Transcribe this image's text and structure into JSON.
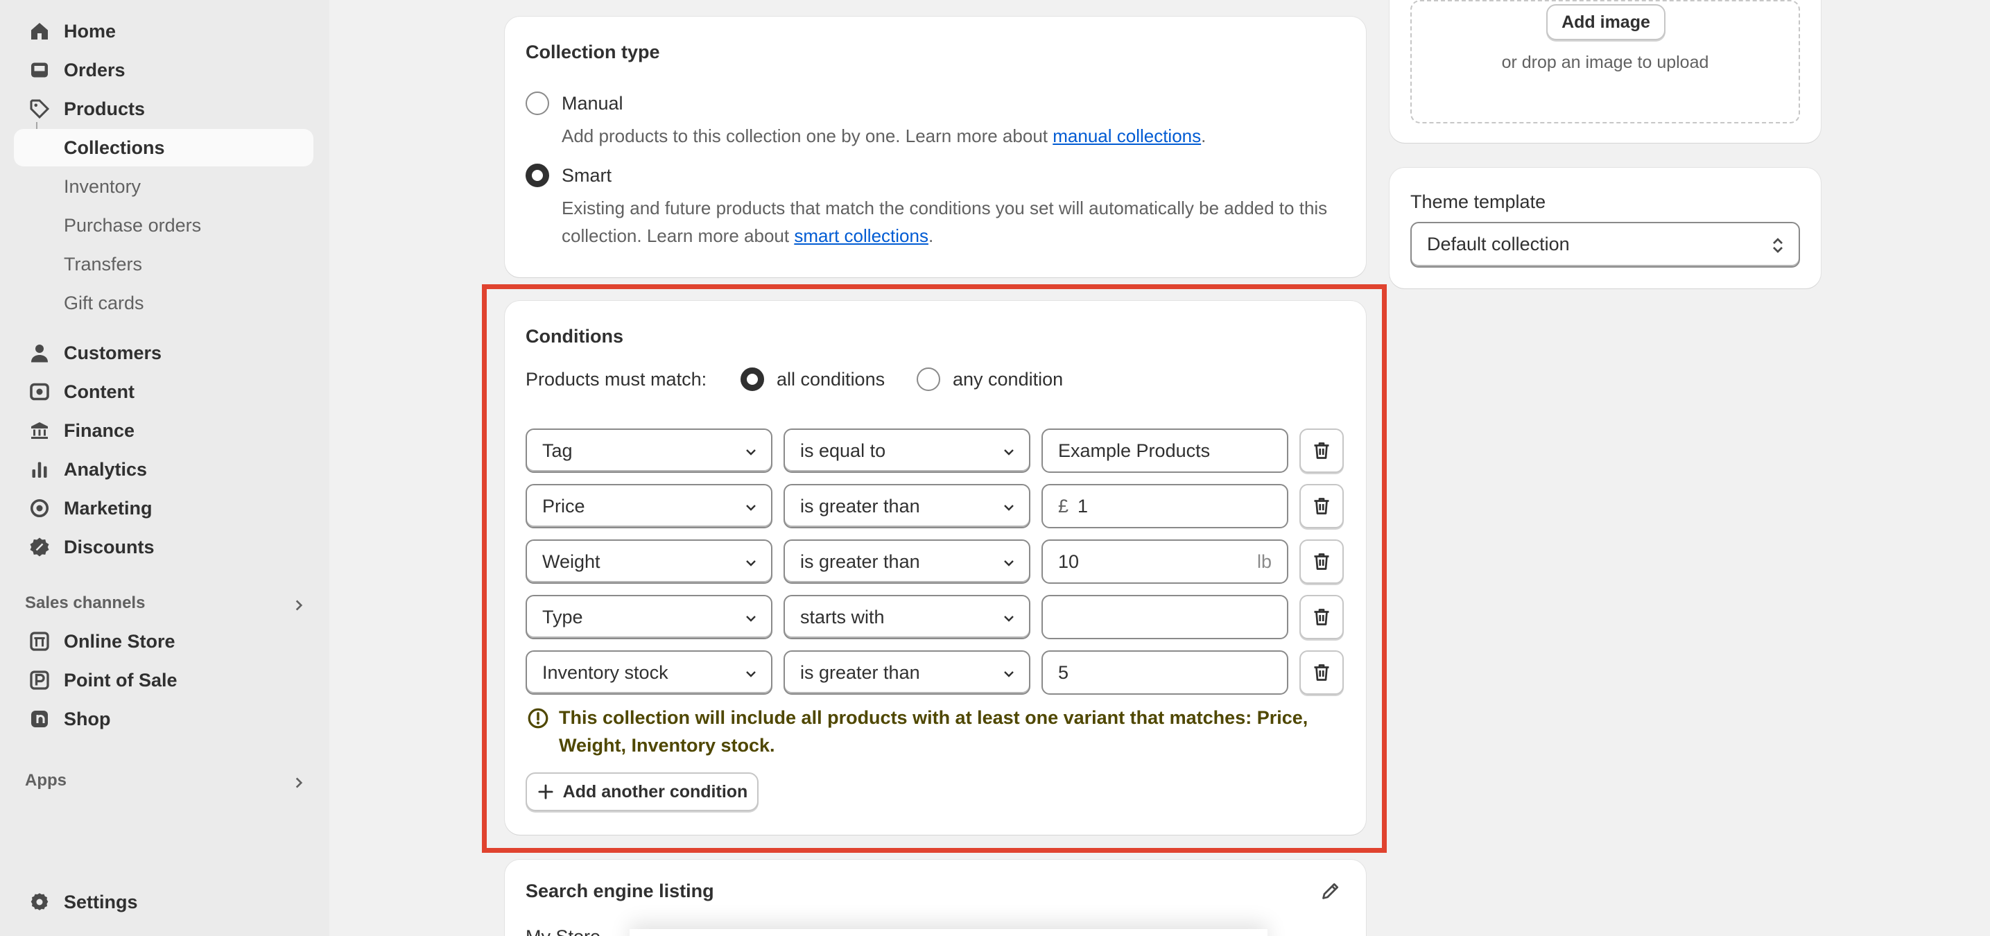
{
  "sidebar": {
    "items": [
      {
        "label": "Home",
        "icon": "home-icon"
      },
      {
        "label": "Orders",
        "icon": "inbox-icon"
      },
      {
        "label": "Products",
        "icon": "tag-icon"
      },
      {
        "label": "Collections"
      },
      {
        "label": "Inventory"
      },
      {
        "label": "Purchase orders"
      },
      {
        "label": "Transfers"
      },
      {
        "label": "Gift cards"
      },
      {
        "label": "Customers",
        "icon": "person-icon"
      },
      {
        "label": "Content",
        "icon": "image-icon"
      },
      {
        "label": "Finance",
        "icon": "bank-icon"
      },
      {
        "label": "Analytics",
        "icon": "bar-chart-icon"
      },
      {
        "label": "Marketing",
        "icon": "target-icon"
      },
      {
        "label": "Discounts",
        "icon": "discount-icon"
      }
    ],
    "sales_channels_title": "Sales channels",
    "channels": [
      {
        "label": "Online Store",
        "icon": "store-icon"
      },
      {
        "label": "Point of Sale",
        "icon": "pos-icon"
      },
      {
        "label": "Shop",
        "icon": "shop-icon"
      }
    ],
    "apps_title": "Apps",
    "settings_label": "Settings"
  },
  "collection_type": {
    "title": "Collection type",
    "manual_label": "Manual",
    "manual_desc": "Add products to this collection one by one. Learn more about",
    "manual_link": "manual collections",
    "smart_label": "Smart",
    "smart_desc": "Existing and future products that match the conditions you set will automatically be added to this collection. Learn more about",
    "smart_link": "smart collections",
    "selected": "Smart"
  },
  "conditions": {
    "title": "Conditions",
    "match_label": "Products must match:",
    "all_label": "all conditions",
    "any_label": "any condition",
    "selected": "all conditions",
    "rows": [
      {
        "field": "Tag",
        "operator": "is equal to",
        "value": "Example Products",
        "prefix": "",
        "suffix": ""
      },
      {
        "field": "Price",
        "operator": "is greater than",
        "value": "1",
        "prefix": "£",
        "suffix": ""
      },
      {
        "field": "Weight",
        "operator": "is greater than",
        "value": "10",
        "prefix": "",
        "suffix": "lb"
      },
      {
        "field": "Type",
        "operator": "starts with",
        "value": "",
        "prefix": "",
        "suffix": ""
      },
      {
        "field": "Inventory stock",
        "operator": "is greater than",
        "value": "5",
        "prefix": "",
        "suffix": ""
      }
    ],
    "warning": "This collection will include all products with at least one variant that matches: Price, Weight, Inventory stock.",
    "add_button": "Add another condition"
  },
  "image_card": {
    "add_button": "Add image",
    "drop_text": "or drop an image to upload"
  },
  "theme_template": {
    "title": "Theme template",
    "value": "Default collection"
  },
  "seo": {
    "title": "Search engine listing",
    "store_name": "My Store"
  },
  "colors": {
    "highlight": "#e0432f",
    "link": "#005bd3",
    "warning_text": "#4f4700"
  }
}
